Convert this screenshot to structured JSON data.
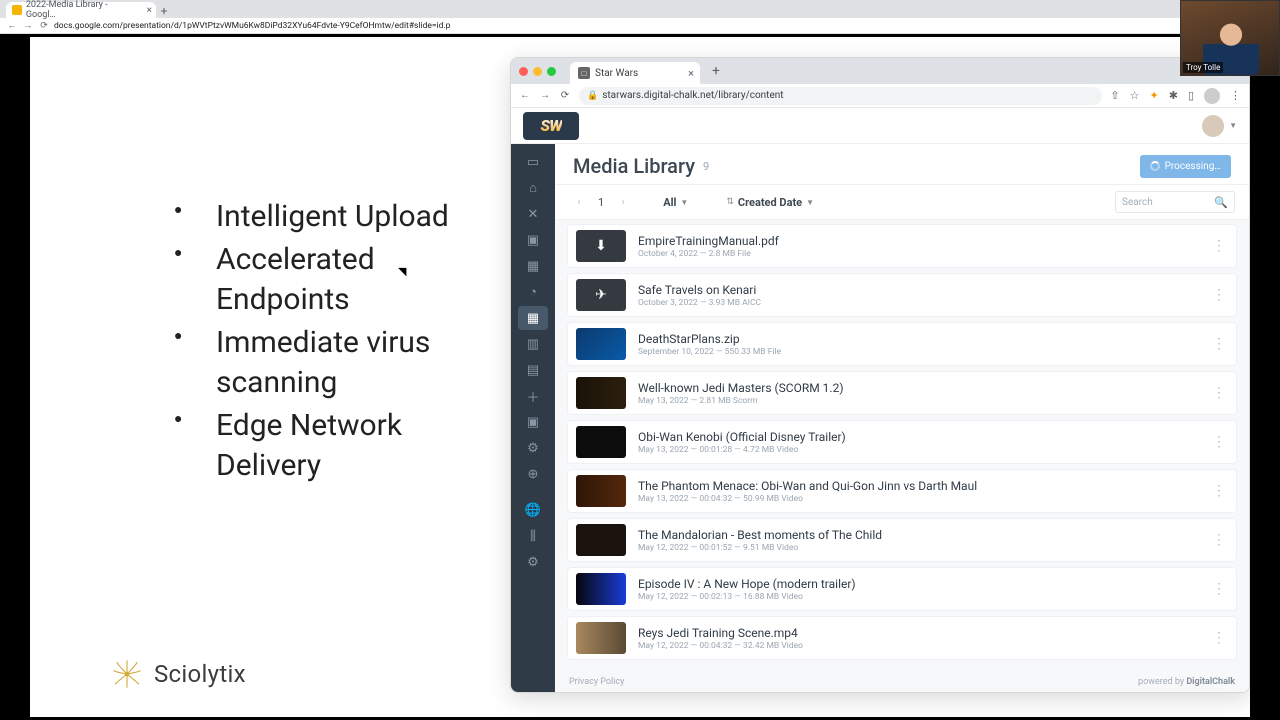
{
  "outer_browser": {
    "tab_title": "2022-Media Library - Googl…",
    "url": "docs.google.com/presentation/d/1pWVtPtzvWMu6Kw8DiPd32XYu64Fdvte-Y9CefOHmtw/edit#slide=id.p"
  },
  "slide": {
    "bullets": [
      "Intelligent Upload",
      "Accelerated Endpoints",
      "Immediate virus scanning",
      "Edge Network Delivery"
    ],
    "brand": "Sciolytix"
  },
  "inner_browser": {
    "tab_title": "Star Wars",
    "tab_fav_text": "□",
    "url": "starwars.digital-chalk.net/library/content"
  },
  "app": {
    "logo_text": "SW",
    "page_title": "Media Library",
    "item_count": "9",
    "processing_label": "Processing…",
    "pager_page": "1",
    "filter_all": "All",
    "sort_label": "Created Date",
    "search_placeholder": "Search",
    "privacy": "Privacy Policy",
    "powered_prefix": "powered by ",
    "powered_brand": "DigitalChalk"
  },
  "items": [
    {
      "title": "EmpireTrainingManual.pdf",
      "meta": "October 4, 2022 — 2.8 MB File",
      "thumb": "file",
      "glyph": "⬇"
    },
    {
      "title": "Safe Travels on Kenari",
      "meta": "October 3, 2022 — 3.93 MB AICC",
      "thumb": "file",
      "glyph": "✈"
    },
    {
      "title": "DeathStarPlans.zip",
      "meta": "September 10, 2022 — 550.33 MB File",
      "thumb": "zip",
      "glyph": ""
    },
    {
      "title": "Well-known Jedi Masters (SCORM 1.2)",
      "meta": "May 13, 2022 — 2.81 MB Scorm",
      "thumb": "dark1",
      "glyph": ""
    },
    {
      "title": "Obi-Wan Kenobi (Official Disney Trailer)",
      "meta": "May 13, 2022 — 00:01:28 — 4.72 MB Video",
      "thumb": "dark2",
      "glyph": ""
    },
    {
      "title": "The Phantom Menace: Obi-Wan and Qui-Gon Jinn vs Darth Maul",
      "meta": "May 13, 2022 — 00:04:32 — 50.99 MB Video",
      "thumb": "dark3",
      "glyph": ""
    },
    {
      "title": "The Mandalorian - Best moments of The Child",
      "meta": "May 12, 2022 — 00:01:52 — 9.51 MB Video",
      "thumb": "dark4",
      "glyph": ""
    },
    {
      "title": "Episode IV : A New Hope (modern trailer)",
      "meta": "May 12, 2022 — 00:02:13 — 16.88 MB Video",
      "thumb": "blue",
      "glyph": ""
    },
    {
      "title": "Reys Jedi Training Scene.mp4",
      "meta": "May 12, 2022 — 00:04:32 — 32.42 MB Video",
      "thumb": "tan",
      "glyph": ""
    }
  ],
  "sidebar_icons": [
    "▭",
    "⌂",
    "✕",
    "▣",
    "▦",
    "◔",
    "▦",
    "▥",
    "▤",
    "＋",
    "▣",
    "⚙",
    "⊕",
    "",
    "🌐",
    "⫼",
    "⚙"
  ],
  "webcam": {
    "name": "Troy Tolle"
  }
}
